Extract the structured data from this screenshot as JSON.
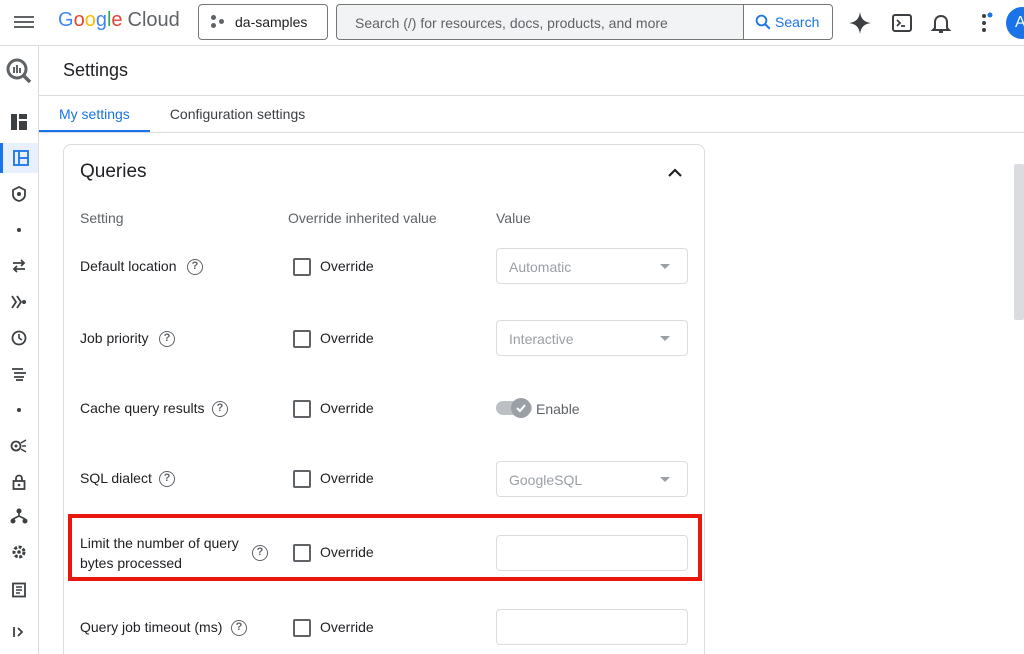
{
  "topbar": {
    "logo": {
      "g1": "G",
      "g2": "o",
      "g3": "o",
      "g4": "g",
      "g5": "l",
      "g6": "e",
      "product": "Cloud"
    },
    "project": "da-samples",
    "search_placeholder": "Search (/) for resources, docs, products, and more",
    "search_button": "Search",
    "avatar_letter": "A"
  },
  "page": {
    "title": "Settings",
    "tabs": [
      {
        "label": "My settings"
      },
      {
        "label": "Configuration settings"
      }
    ]
  },
  "queries": {
    "title": "Queries",
    "columns": {
      "setting": "Setting",
      "override": "Override inherited value",
      "value": "Value"
    },
    "override_label": "Override",
    "rows": [
      {
        "label": "Default location",
        "value": "Automatic"
      },
      {
        "label": "Job priority",
        "value": "Interactive"
      },
      {
        "label": "Cache query results",
        "value": "Enable"
      },
      {
        "label": "SQL dialect",
        "value": "GoogleSQL"
      },
      {
        "label_line1": "Limit the number of query",
        "label_line2": "bytes processed",
        "value": ""
      },
      {
        "label": "Query job timeout (ms)",
        "value": ""
      }
    ]
  },
  "colors": {
    "accent": "#1a73e8",
    "highlight": "#e8160c"
  }
}
